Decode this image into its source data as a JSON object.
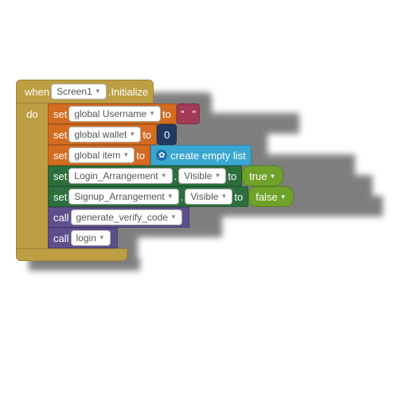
{
  "when": {
    "label": "when",
    "component": "Screen1",
    "event": ".Initialize",
    "do_label": "do"
  },
  "rows": [
    {
      "kind": "set_global",
      "set": "set",
      "var": "global Username",
      "to": "to",
      "value_kind": "string",
      "value": " "
    },
    {
      "kind": "set_global",
      "set": "set",
      "var": "global wallet",
      "to": "to",
      "value_kind": "number",
      "value": "0"
    },
    {
      "kind": "set_global",
      "set": "set",
      "var": "global item",
      "to": "to",
      "value_kind": "list",
      "value": "create empty list"
    },
    {
      "kind": "set_component",
      "set": "set",
      "component": "Login_Arrangement",
      "dot": ".",
      "property": "Visible",
      "to": "to",
      "value_kind": "bool",
      "value": "true"
    },
    {
      "kind": "set_component",
      "set": "set",
      "component": "Signup_Arrangement",
      "dot": ".",
      "property": "Visible",
      "to": "to",
      "value_kind": "bool",
      "value": "false"
    },
    {
      "kind": "call",
      "call": "call",
      "proc": "generate_verify_code"
    },
    {
      "kind": "call",
      "call": "call",
      "proc": "login"
    }
  ],
  "colors": {
    "when": "#be9e43",
    "orange": "#d36c20",
    "green": "#2c6f3d",
    "purple": "#5e4f8c",
    "teal": "#3aa7d0",
    "number": "#223a62",
    "string": "#a33a57",
    "bool": "#6fa22a"
  }
}
